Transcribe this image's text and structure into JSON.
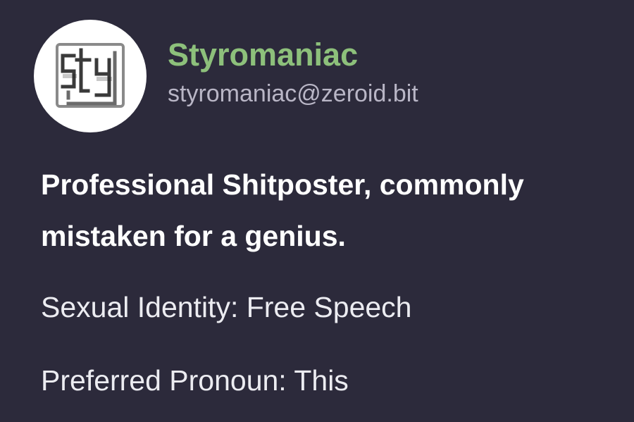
{
  "profile": {
    "display_name": "Styromaniac",
    "handle": "styromaniac@zeroid.bit",
    "avatar_icon": "sty-monogram-logo",
    "bio": {
      "headline": "Professional Shitposter, commonly mistaken for a genius.",
      "lines": [
        "Sexual Identity: Free Speech",
        "Preferred Pronoun: This"
      ]
    }
  },
  "colors": {
    "background": "#2c2a3b",
    "display_name": "#8dc07b",
    "handle": "#b9b6c6",
    "text": "#ffffff"
  }
}
